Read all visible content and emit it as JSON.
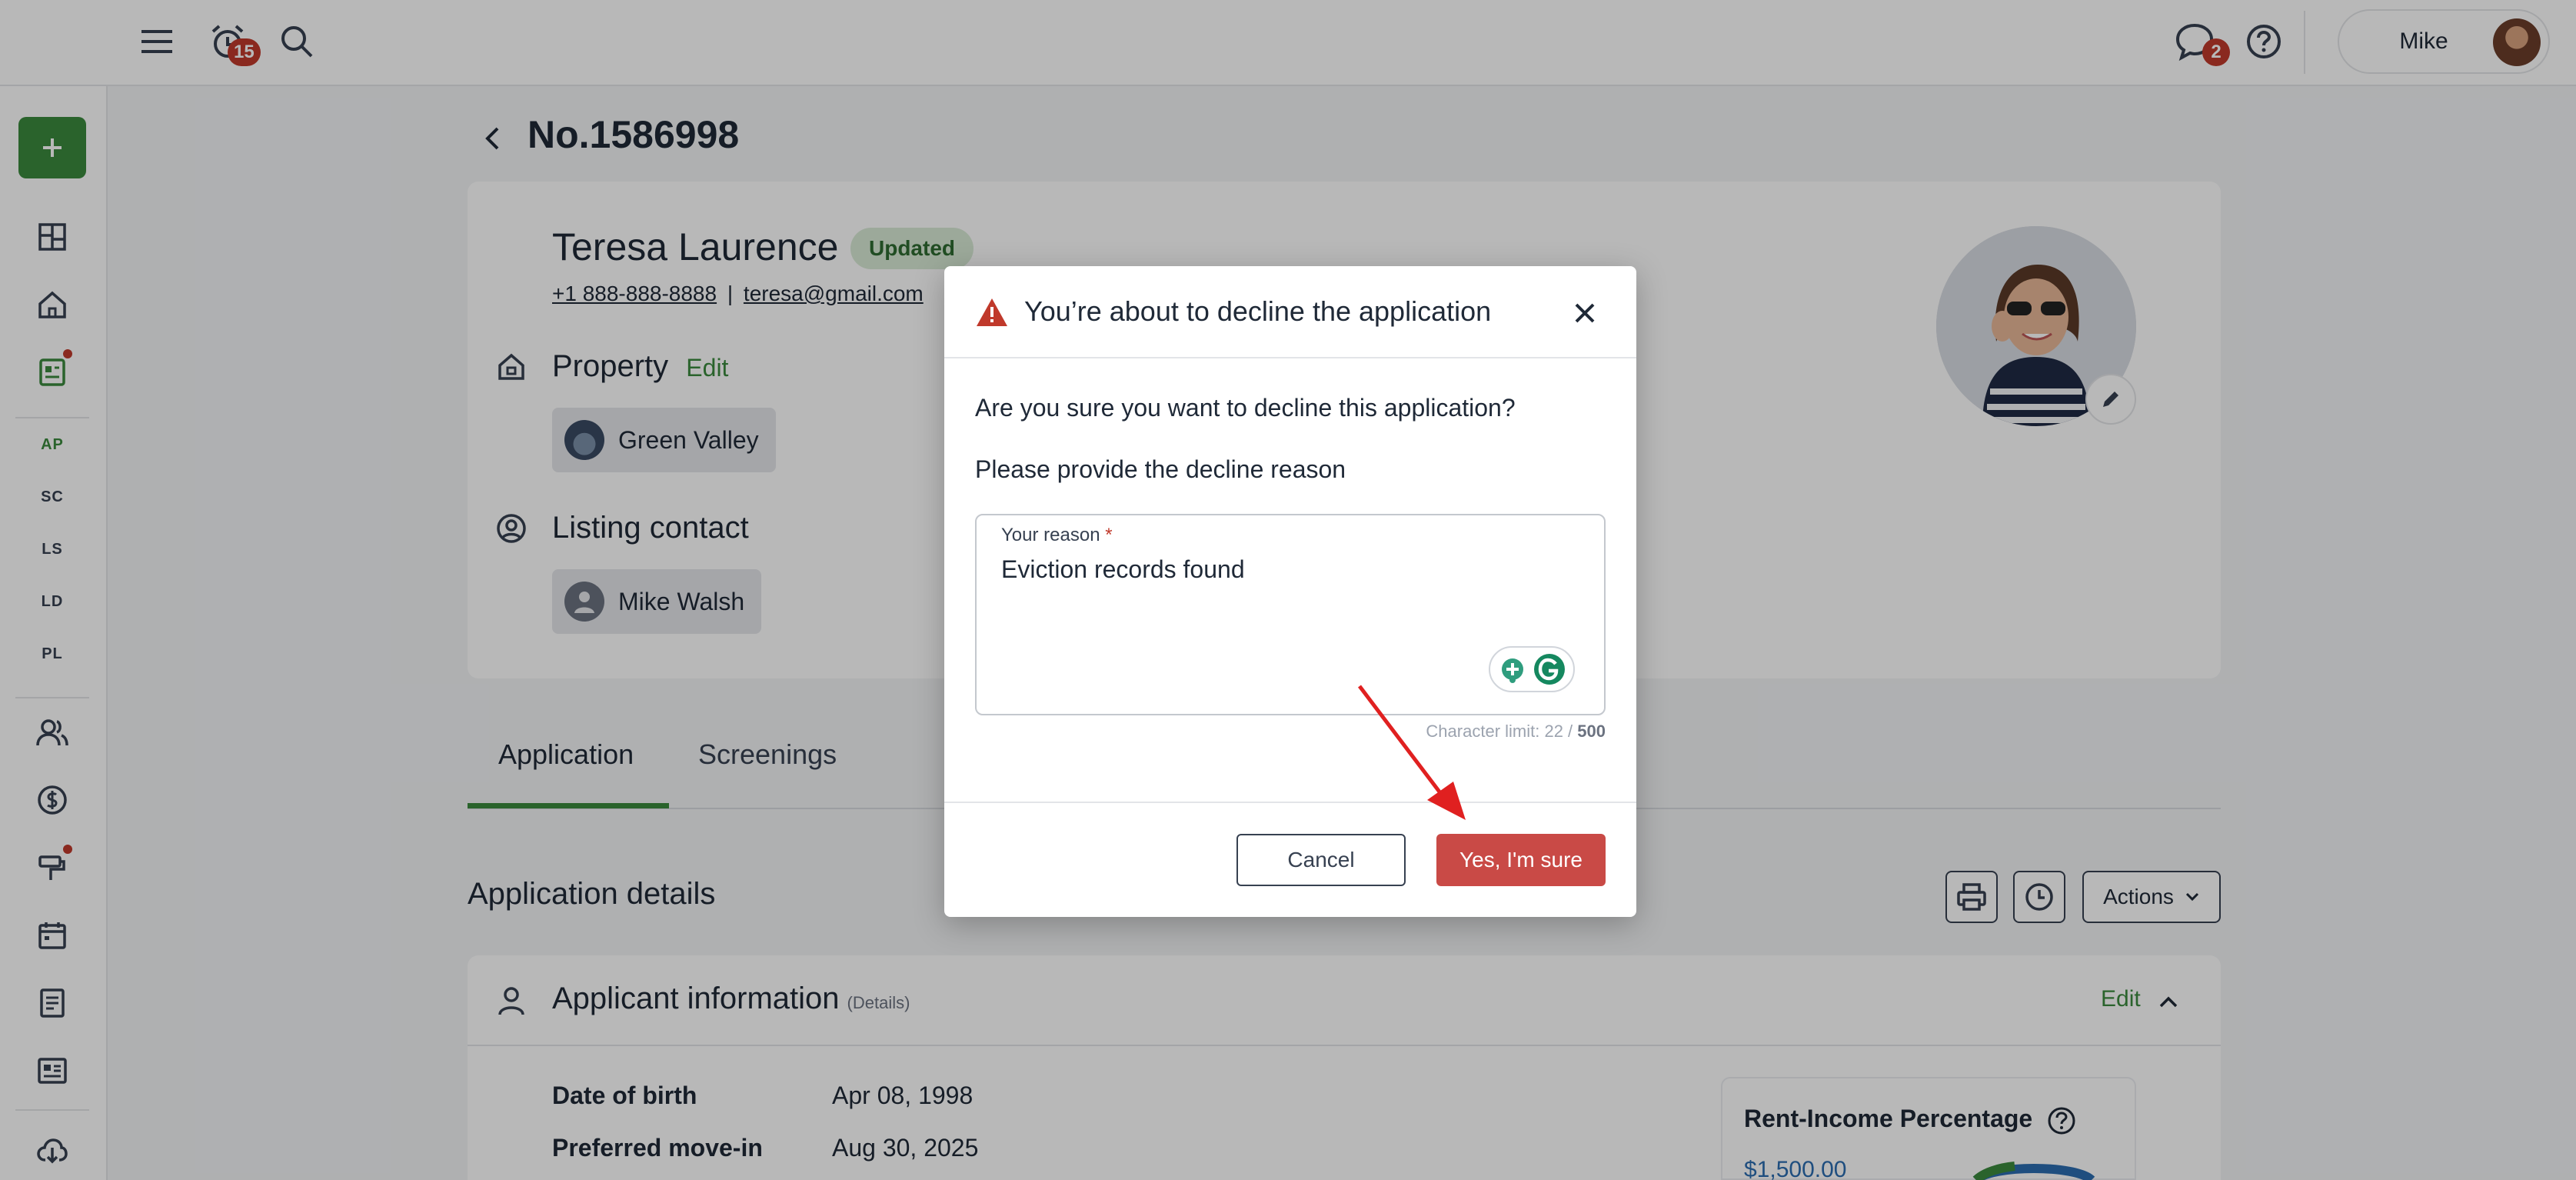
{
  "topbar": {
    "notifications_count": "15",
    "messages_count": "2",
    "user_name": "Mike"
  },
  "sidebar": {
    "sections": [
      "AP",
      "SC",
      "LS",
      "LD",
      "PL"
    ]
  },
  "page": {
    "title": "No.1586998"
  },
  "applicant": {
    "name": "Teresa Laurence",
    "status": "Updated",
    "phone": "+1 888-888-8888",
    "separator": "|",
    "email": "teresa@gmail.com"
  },
  "property": {
    "label": "Property",
    "edit_label": "Edit",
    "value": "Green Valley"
  },
  "listing_contact": {
    "label": "Listing contact",
    "value": "Mike Walsh"
  },
  "tabs": [
    {
      "label": "Application"
    },
    {
      "label": "Screenings"
    }
  ],
  "application_details": {
    "title": "Application details",
    "actions_label": "Actions"
  },
  "applicant_info": {
    "title": "Applicant information",
    "subtitle": "(Details)",
    "edit_label": "Edit",
    "rows": [
      {
        "label": "Date of birth",
        "value": "Apr 08, 1998"
      },
      {
        "label": "Preferred move-in",
        "value": "Aug 30, 2025"
      }
    ],
    "rent_income": {
      "title": "Rent-Income Percentage",
      "amount": "$1,500.00"
    }
  },
  "modal": {
    "title": "You’re about to decline the application",
    "question": "Are you sure you want to decline this application?",
    "instruction": "Please provide the decline reason",
    "field_label": "Your reason",
    "required_mark": "*",
    "field_value": "Eviction records found",
    "char_limit_prefix": "Character limit: 22 /",
    "char_limit_max": "500",
    "cancel_label": "Cancel",
    "confirm_label": "Yes, I'm sure"
  },
  "colors": {
    "brand_green": "#3b8a3e",
    "danger_red": "#c94a46",
    "badge_red": "#c0392b",
    "annotation_arrow": "#e02020"
  }
}
